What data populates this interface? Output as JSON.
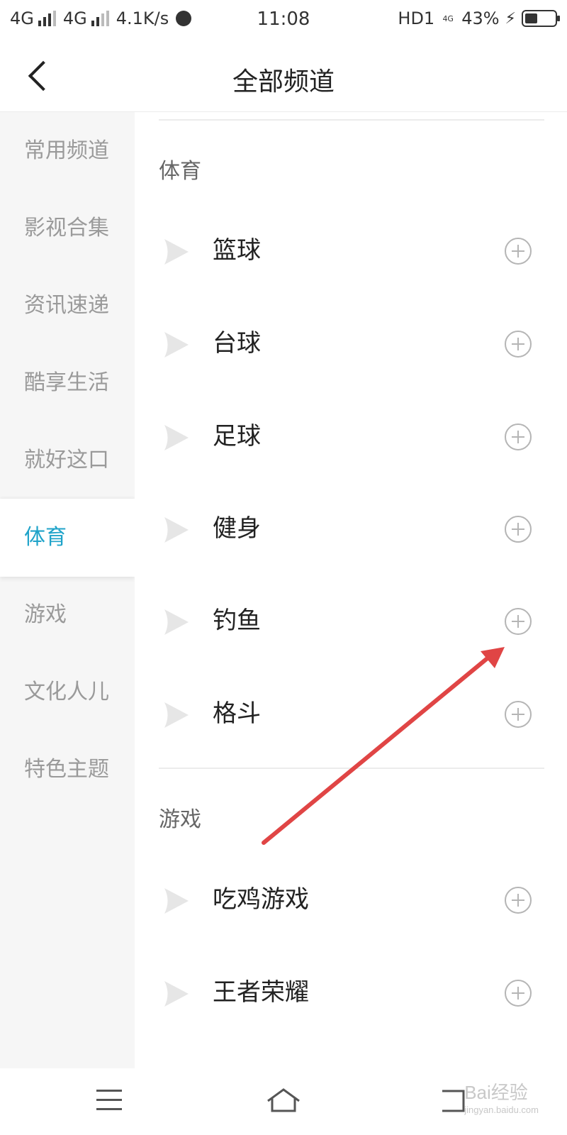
{
  "status_bar": {
    "signal1": "4G",
    "signal2": "4G",
    "speed": "4.1K/s",
    "time": "11:08",
    "hd": "HD1",
    "net": "4G",
    "battery": "43%",
    "battery_level": 0.43
  },
  "header": {
    "title": "全部频道"
  },
  "sidebar": {
    "items": [
      {
        "label": "常用频道"
      },
      {
        "label": "影视合集"
      },
      {
        "label": "资讯速递"
      },
      {
        "label": "酷享生活"
      },
      {
        "label": "就好这口"
      },
      {
        "label": "体育",
        "active": true
      },
      {
        "label": "游戏"
      },
      {
        "label": "文化人儿"
      },
      {
        "label": "特色主题"
      }
    ]
  },
  "sections": [
    {
      "title": "体育",
      "channels": [
        {
          "name": "篮球"
        },
        {
          "name": "台球"
        },
        {
          "name": "足球"
        },
        {
          "name": "健身"
        },
        {
          "name": "钓鱼"
        },
        {
          "name": "格斗"
        }
      ]
    },
    {
      "title": "游戏",
      "channels": [
        {
          "name": "吃鸡游戏"
        },
        {
          "name": "王者荣耀"
        }
      ]
    }
  ],
  "watermark": {
    "text": "Bai经验",
    "sub": "jingyan.baidu.com"
  },
  "colors": {
    "accent": "#1fa3c9",
    "annotation_arrow": "#e04545",
    "sidebar_bg": "#f6f6f6"
  }
}
